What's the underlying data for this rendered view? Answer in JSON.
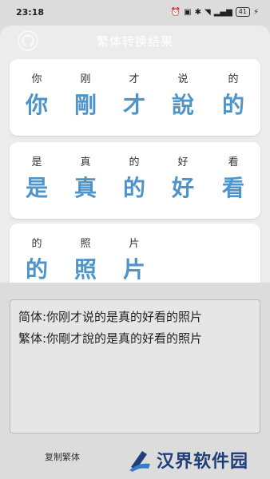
{
  "status_bar": {
    "time": "23:18",
    "battery": "41"
  },
  "header": {
    "title": "繁体转换结果",
    "icon": "github-icon"
  },
  "cards": [
    {
      "chars": [
        {
          "pinyin": "你",
          "hanzi": "你"
        },
        {
          "pinyin": "刚",
          "hanzi": "剛"
        },
        {
          "pinyin": "才",
          "hanzi": "才"
        },
        {
          "pinyin": "说",
          "hanzi": "說"
        },
        {
          "pinyin": "的",
          "hanzi": "的"
        }
      ]
    },
    {
      "chars": [
        {
          "pinyin": "是",
          "hanzi": "是"
        },
        {
          "pinyin": "真",
          "hanzi": "真"
        },
        {
          "pinyin": "的",
          "hanzi": "的"
        },
        {
          "pinyin": "好",
          "hanzi": "好"
        },
        {
          "pinyin": "看",
          "hanzi": "看"
        }
      ]
    },
    {
      "chars": [
        {
          "pinyin": "的",
          "hanzi": "的"
        },
        {
          "pinyin": "照",
          "hanzi": "照"
        },
        {
          "pinyin": "片",
          "hanzi": "片"
        }
      ]
    }
  ],
  "result": {
    "simplified": "简体:你刚才说的是真的好看的照片",
    "traditional": "繁体:你剛才說的是真的好看的照片"
  },
  "copy_button": "复制繁体",
  "watermark": {
    "text": "汉界软件园"
  },
  "colors": {
    "accent": "#4e94c8",
    "title": "#ffffff",
    "watermark": "#1f3f7a"
  }
}
